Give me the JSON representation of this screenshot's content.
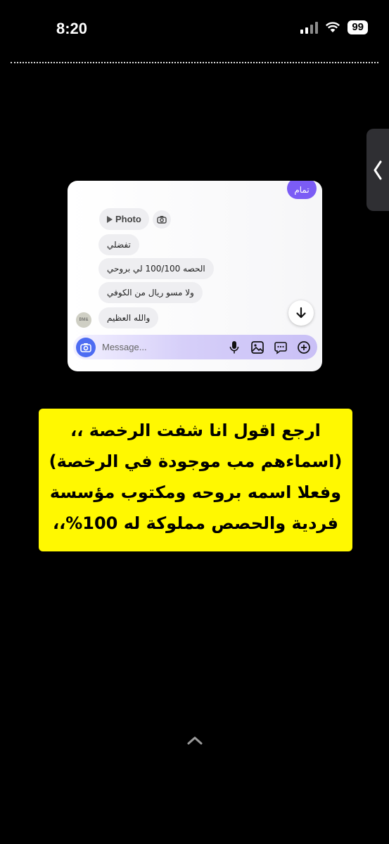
{
  "status_bar": {
    "time": "8:20",
    "battery": "99"
  },
  "chat": {
    "done_chip": "تمام",
    "photo_label": "Photo",
    "messages": [
      "تفضلي",
      "الحصه 100/100 لي بروحي",
      "ولا مسو ريال من الكوفي",
      "والله العظيم"
    ],
    "avatar_text": "BM&",
    "composer_placeholder": "Message..."
  },
  "caption": {
    "lines": [
      "ارجع اقول انا شفت الرخصة ،،",
      "(اسماءهم مب موجودة في الرخصة)",
      "وفعلا اسمه بروحه ومكتوب مؤسسة",
      "فردية والحصص مملوكة له 100%،،"
    ]
  },
  "colors": {
    "accent_purple": "#7b5cf5",
    "caption_yellow": "#fff801",
    "camera_blue": "#4d6cf2"
  },
  "icons": [
    "signal-icon",
    "wifi-icon",
    "battery-icon",
    "chevron-left-icon",
    "play-icon",
    "camera-icon",
    "arrow-down-icon",
    "mic-icon",
    "image-icon",
    "sticker-icon",
    "plus-circle-icon",
    "chevron-up-icon"
  ]
}
